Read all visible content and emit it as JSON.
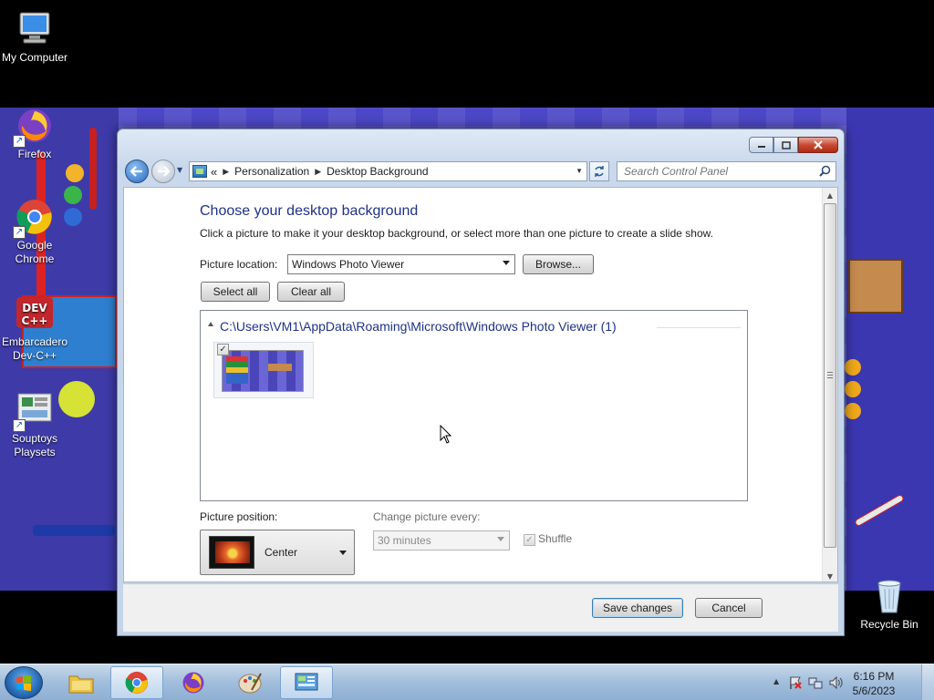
{
  "desktop": {
    "icons": [
      {
        "label": "My Computer"
      },
      {
        "label": "Firefox"
      },
      {
        "label": "Google Chrome"
      },
      {
        "label": "Embarcadero Dev-C++"
      },
      {
        "label": "Souptoys Playsets"
      },
      {
        "label": "Recycle Bin"
      }
    ]
  },
  "window": {
    "breadcrumb": [
      "Personalization",
      "Desktop Background"
    ],
    "breadcrumb_prefix": "«",
    "search_placeholder": "Search Control Panel",
    "heading": "Choose your desktop background",
    "subtext": "Click a picture to make it your desktop background, or select more than one picture to create a slide show.",
    "picture_location_label": "Picture location:",
    "picture_location_value": "Windows Photo Viewer",
    "browse_label": "Browse...",
    "select_all_label": "Select all",
    "clear_all_label": "Clear all",
    "group_title": "C:\\Users\\VM1\\AppData\\Roaming\\Microsoft\\Windows Photo Viewer (1)",
    "thumbnail_checked": "✓",
    "picture_position_label": "Picture position:",
    "picture_position_value": "Center",
    "change_every_label": "Change picture every:",
    "change_every_value": "30 minutes",
    "shuffle_label": "Shuffle",
    "save_label": "Save changes",
    "cancel_label": "Cancel"
  },
  "taskbar": {
    "time": "6:16 PM",
    "date": "5/6/2023"
  },
  "colors": {
    "heading": "#1e3287",
    "wallpaper": "#4c47c6"
  }
}
